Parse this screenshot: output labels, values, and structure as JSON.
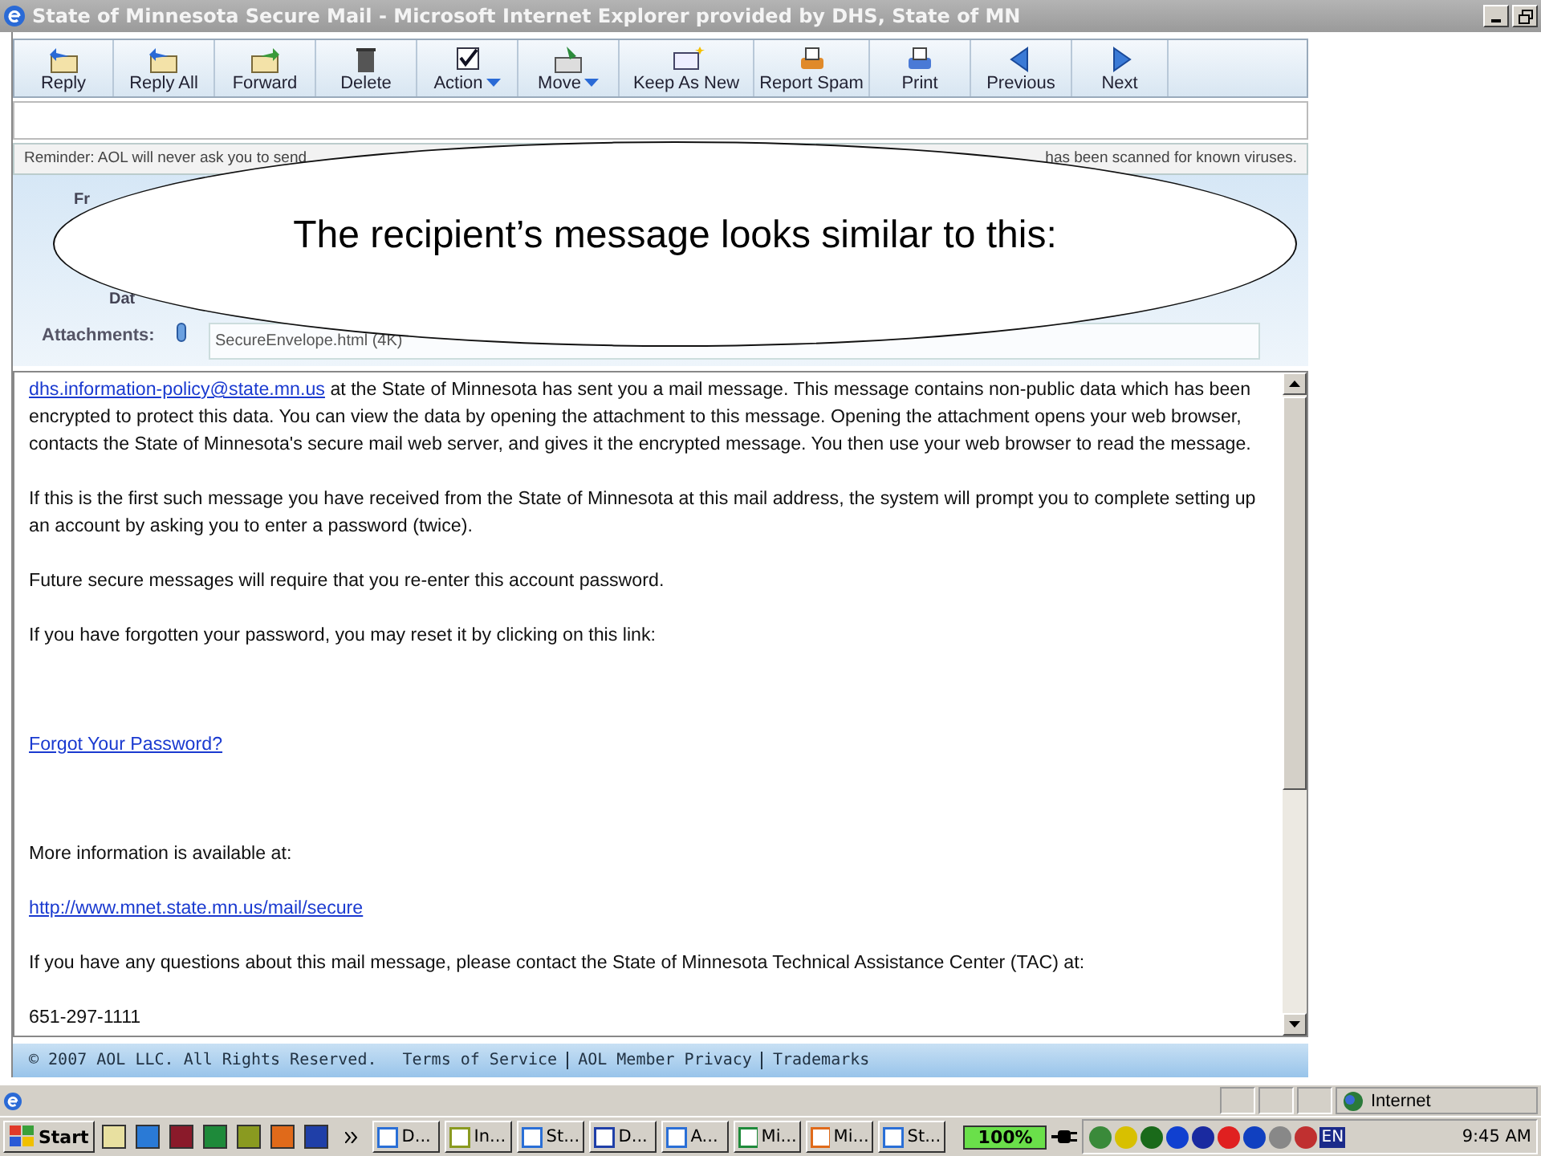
{
  "window": {
    "title": "State of Minnesota Secure Mail - Microsoft Internet Explorer provided by DHS, State of MN"
  },
  "toolbar": [
    {
      "label": "Reply",
      "dropdown": false
    },
    {
      "label": "Reply All",
      "dropdown": false
    },
    {
      "label": "Forward",
      "dropdown": false
    },
    {
      "label": "Delete",
      "dropdown": false
    },
    {
      "label": "Action",
      "dropdown": true
    },
    {
      "label": "Move",
      "dropdown": true
    },
    {
      "label": "Keep As New",
      "dropdown": false
    },
    {
      "label": "Report Spam",
      "dropdown": false
    },
    {
      "label": "Print",
      "dropdown": false
    },
    {
      "label": "Previous",
      "dropdown": false
    },
    {
      "label": "Next",
      "dropdown": false
    }
  ],
  "reminder": {
    "left": "Reminder: AOL will never ask you to send",
    "right": "has been scanned for known viruses."
  },
  "header": {
    "labels": [
      "Fr",
      "Dat"
    ],
    "attachments_label": "Attachments:",
    "attachment": "SecureEnvelope.html (4K)"
  },
  "callout": "The recipient’s message looks similar to this:",
  "body": [
    {
      "link": "dhs.information-policy@state.mn.us",
      "text": " at the State of Minnesota has sent you a mail message. This message contains non-public data which has been encrypted to protect this data. You can view the data by opening the attachment to this message. Opening the attachment opens your web browser, contacts the State of Minnesota's secure mail web server, and gives it the encrypted message. You then use your web browser to read the message."
    },
    {
      "text": "If this is the first such message you have received from the State of Minnesota at this mail address, the system will prompt you to complete setting up an account by asking you to enter a password (twice)."
    },
    {
      "text": "Future secure messages will require that you re-enter this account password."
    },
    {
      "text": "If you have forgotten your password, you may reset it by clicking on this link:"
    },
    {
      "link": "Forgot Your Password?"
    },
    {
      "text": "More information is available at:"
    },
    {
      "link": "http://www.mnet.state.mn.us/mail/secure"
    },
    {
      "text": "If you have any questions about this mail message, please contact the State of Minnesota Technical Assistance Center (TAC) at:"
    },
    {
      "text": "651-297-1111"
    }
  ],
  "footer": {
    "copyright": "© 2007 AOL LLC. All Rights Reserved.",
    "links": [
      "Terms of Service",
      "AOL Member Privacy",
      "Trademarks"
    ]
  },
  "status_bar": {
    "zone": "Internet"
  },
  "taskbar": {
    "start": "Start",
    "tasks": [
      "D...",
      "In...",
      "St...",
      "D...",
      "A...",
      "Mi...",
      "Mi...",
      "St..."
    ],
    "battery": "100%",
    "language": "EN",
    "clock": "9:45 AM"
  }
}
